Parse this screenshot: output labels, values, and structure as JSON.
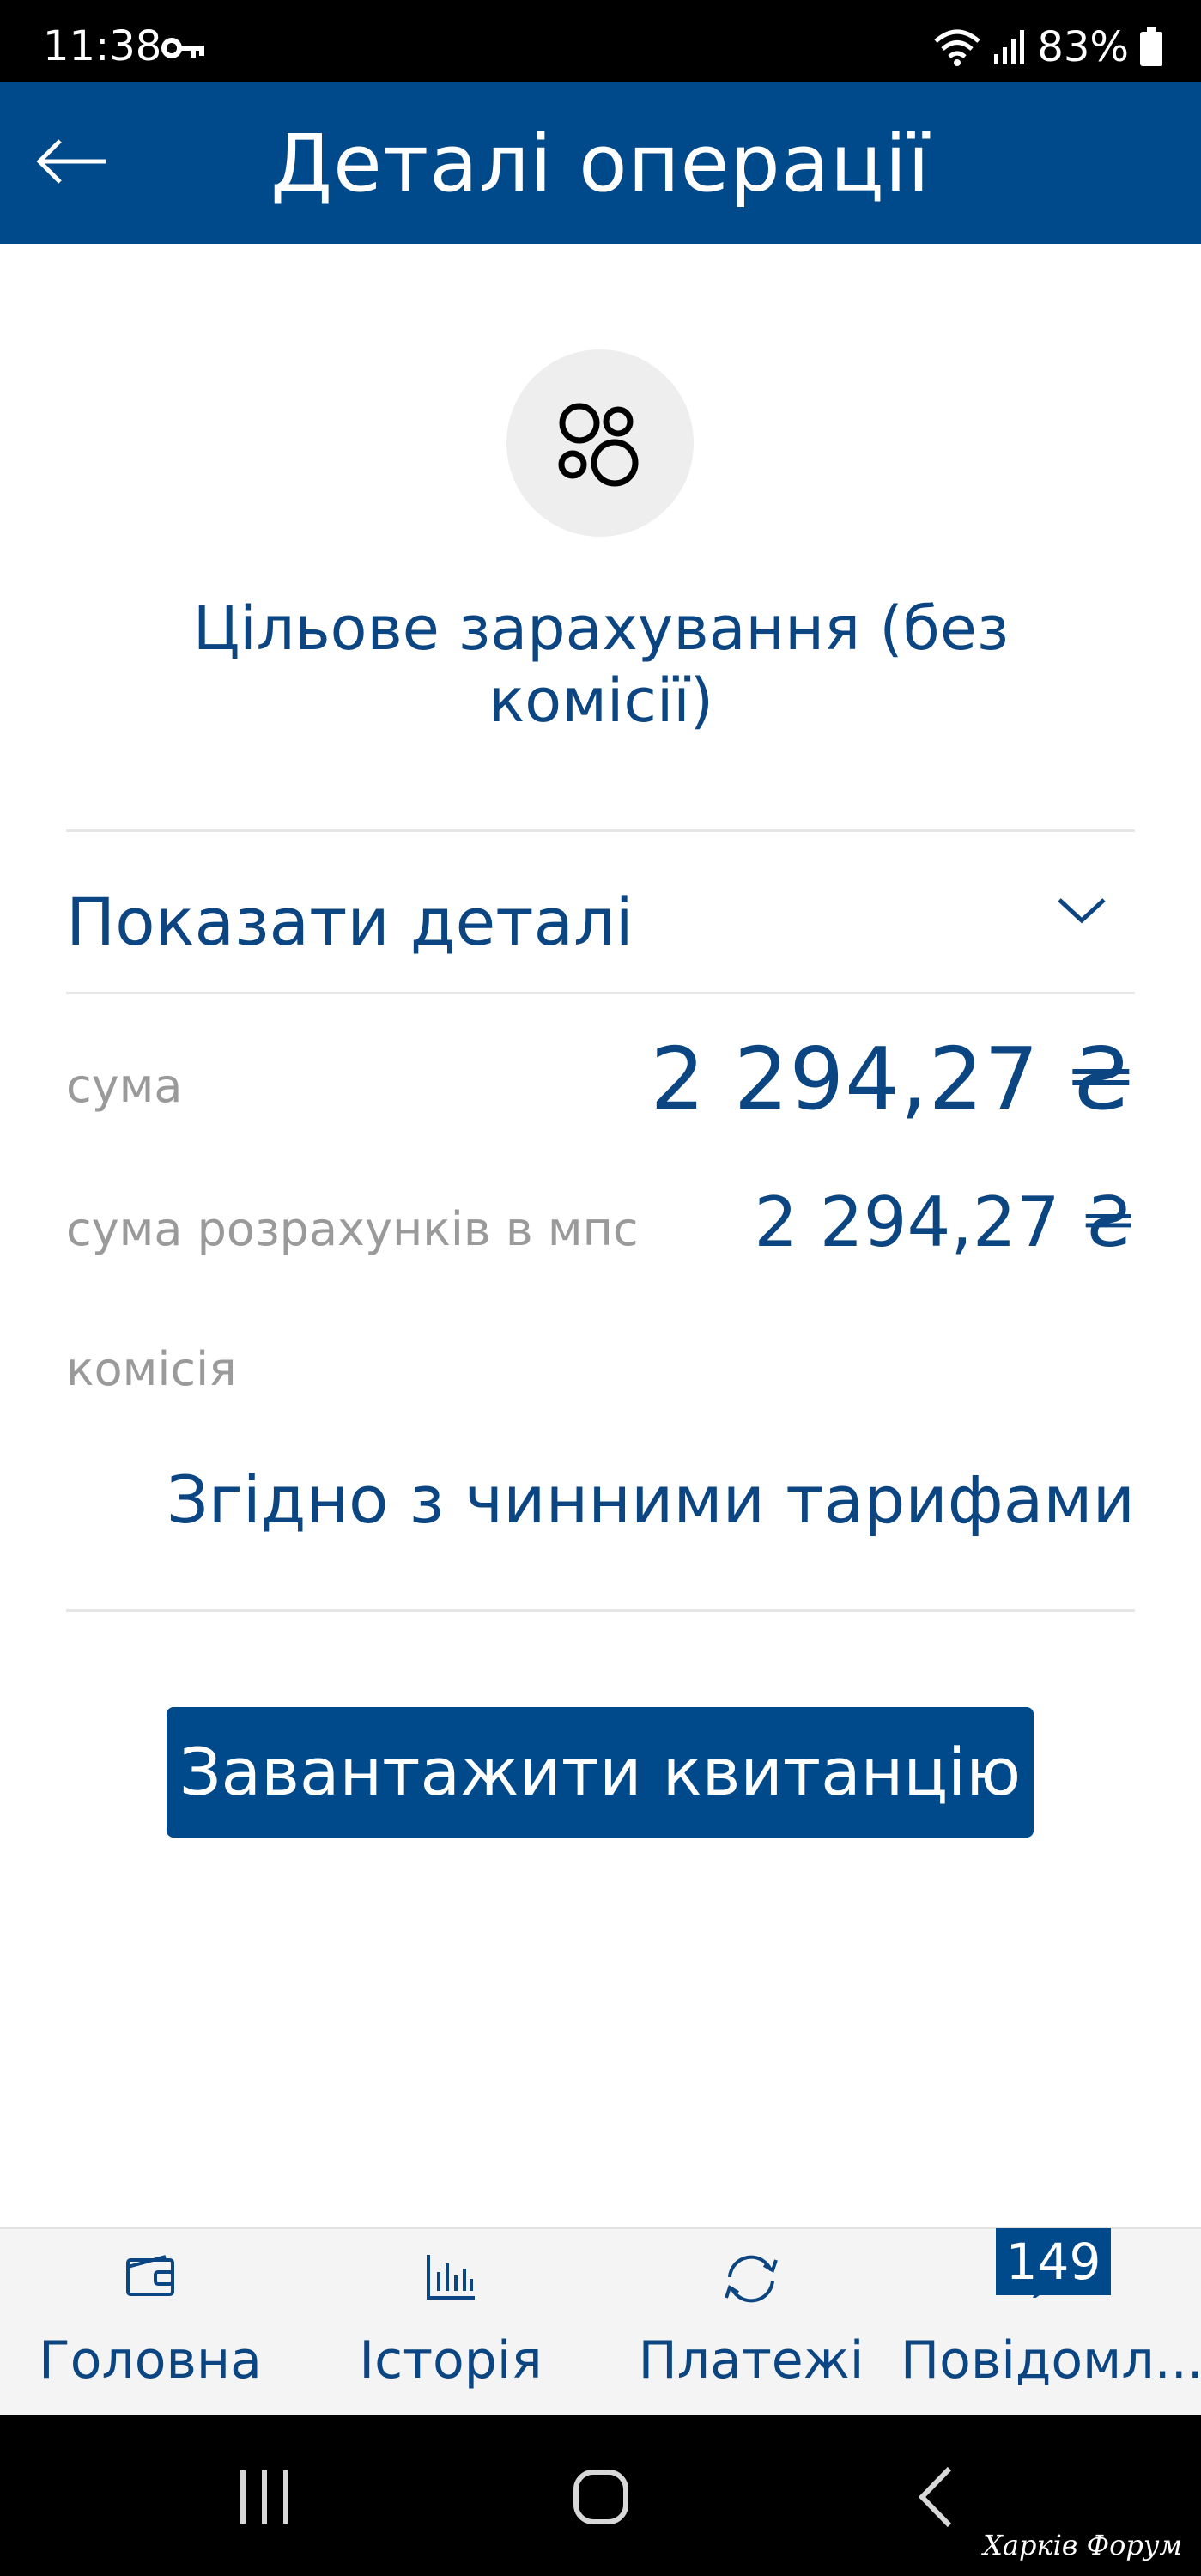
{
  "status_bar": {
    "time": "11:38",
    "battery": "83%",
    "icons": [
      "vpn-key-icon",
      "wifi-icon",
      "signal-icon",
      "battery-icon"
    ]
  },
  "header": {
    "title": "Деталі операції",
    "back_icon": "arrow-left-icon"
  },
  "operation": {
    "icon": "coins-icon",
    "title": "Цільове зарахування (без комісії)"
  },
  "details_toggle": {
    "label": "Показати деталі",
    "icon": "chevron-down-icon"
  },
  "details": {
    "amount_label": "сума",
    "amount_value": "2 294,27 ₴",
    "settlement_label": "сума розрахунків в мпс",
    "settlement_value": "2 294,27 ₴",
    "commission_label": "комісія",
    "commission_value": "Згідно з чинними тарифами"
  },
  "actions": {
    "download_receipt": "Завантажити квитанцію"
  },
  "bottom_nav": {
    "items": [
      {
        "label": "Головна",
        "icon": "wallet-icon"
      },
      {
        "label": "Історія",
        "icon": "bar-chart-icon"
      },
      {
        "label": "Платежі",
        "icon": "refresh-icon"
      },
      {
        "label": "Повідомл...",
        "icon": "message-icon"
      }
    ],
    "badge": "149"
  },
  "system_nav": {
    "icons": [
      "recent-apps-icon",
      "home-icon",
      "back-icon"
    ]
  },
  "watermark": "Харків Форум",
  "colors": {
    "brand": "#004a8b",
    "text_primary": "#0b4582",
    "text_secondary": "#9a9a9a"
  }
}
